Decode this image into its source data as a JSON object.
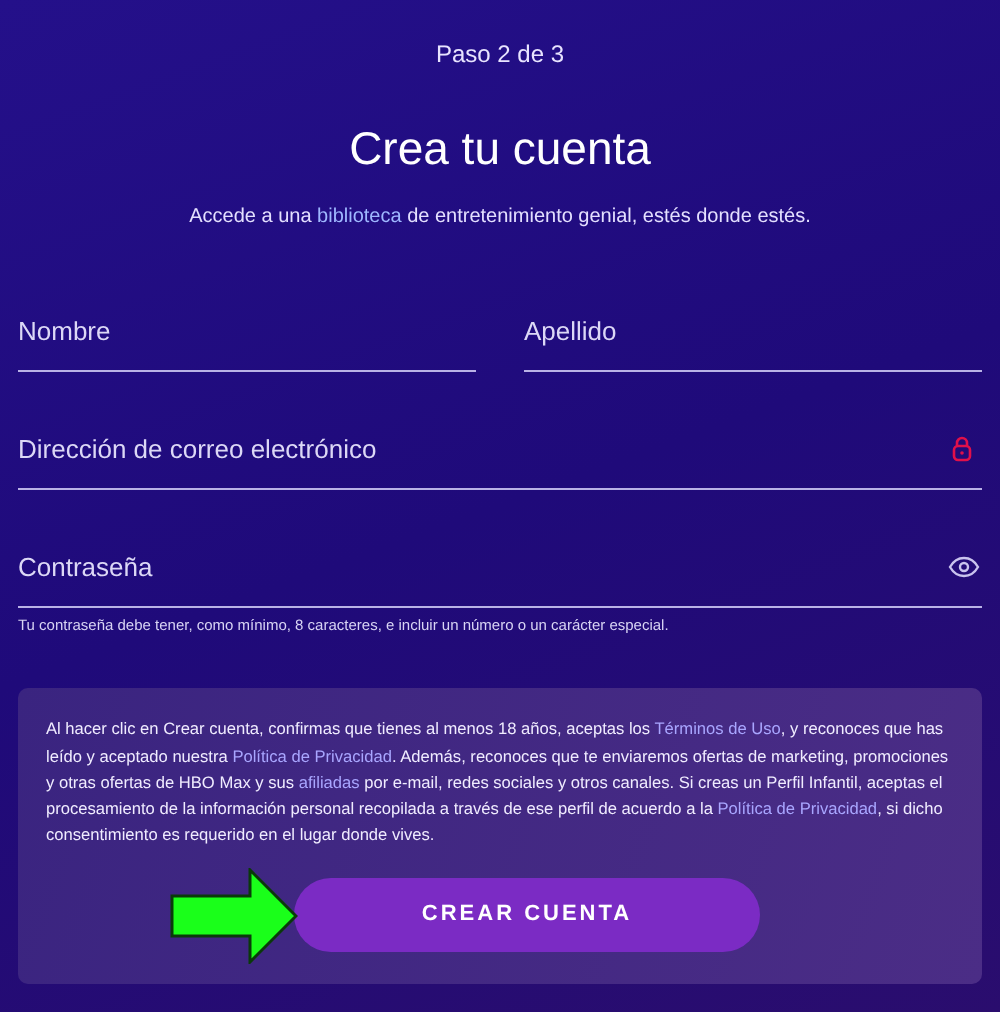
{
  "step": "Paso 2 de 3",
  "title": "Crea tu cuenta",
  "subtitle": [
    {
      "text": "Accede a una ",
      "link": false
    },
    {
      "text": "biblioteca",
      "link": true
    },
    {
      "text": " de entretenimiento genial, estés donde estés.",
      "link": false
    }
  ],
  "fields": [
    {
      "placeholder": "Nombre",
      "kind": "half"
    },
    {
      "placeholder": "Apellido",
      "kind": "half"
    },
    {
      "placeholder": "Dirección de correo electrónico",
      "kind": "email"
    },
    {
      "placeholder": "Contraseña",
      "kind": "password"
    }
  ],
  "password_hint": "Tu contraseña debe tener, como mínimo, 8 caracteres, e incluir un número o un carácter especial.",
  "legal": [
    {
      "text": "Al hacer clic en Crear cuenta, confirmas que tienes al menos 18 años, aceptas los ",
      "link": false
    },
    {
      "text": "Términos de Uso",
      "link": true
    },
    {
      "text": ", y reconoces que has leído y aceptado nuestra ",
      "link": false
    },
    {
      "text": "Política de Privacidad",
      "link": true
    },
    {
      "text": ". Además, reconoces que te enviaremos ofertas de marketing, promociones y otras ofertas de HBO Max y sus ",
      "link": false
    },
    {
      "text": "afiliadas",
      "link": true
    },
    {
      "text": " por e-mail, redes sociales y otros canales. Si creas un Perfil Infantil, aceptas el procesamiento de la información personal recopilada a través de ese perfil de acuerdo a la ",
      "link": false
    },
    {
      "text": "Política de Privacidad",
      "link": true
    },
    {
      "text": ", si dicho consentimiento es requerido en el lugar donde vives.",
      "link": false
    }
  ],
  "button": "CREAR CUENTA"
}
